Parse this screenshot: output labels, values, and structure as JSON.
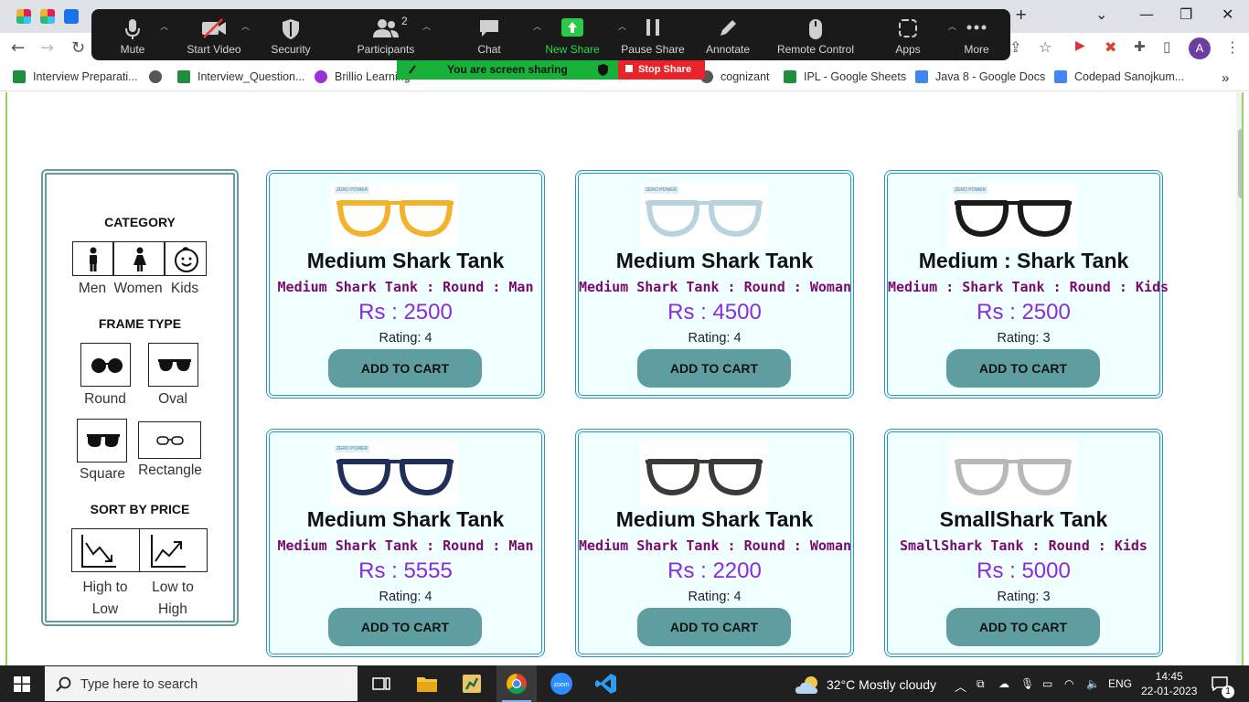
{
  "browser": {
    "bookmarks": [
      "Interview Preparati...",
      "Interview_Question...",
      "Brillio Learning",
      "cognizant",
      "IPL - Google Sheets",
      "Java 8 - Google Docs",
      "Codepad Sanojkum..."
    ],
    "overflow": "»",
    "avatar": "A"
  },
  "zoom": {
    "buttons": [
      {
        "label": "Mute",
        "icon": "microphone-icon"
      },
      {
        "label": "Start Video",
        "icon": "video-off-icon"
      },
      {
        "label": "Security",
        "icon": "shield-icon"
      },
      {
        "label": "Participants",
        "icon": "participants-icon",
        "count": "2"
      },
      {
        "label": "Chat",
        "icon": "chat-icon"
      },
      {
        "label": "New Share",
        "icon": "share-arrow-icon"
      },
      {
        "label": "Pause Share",
        "icon": "pause-icon"
      },
      {
        "label": "Annotate",
        "icon": "pencil-icon"
      },
      {
        "label": "Remote Control",
        "icon": "mouse-icon"
      },
      {
        "label": "Apps",
        "icon": "apps-icon"
      },
      {
        "label": "More",
        "icon": "more-dots-icon"
      }
    ],
    "sharing_status": "You are screen sharing",
    "stop_share": "Stop Share"
  },
  "filters": {
    "category_heading": "CATEGORY",
    "categories": [
      "Men",
      "Women",
      "Kids"
    ],
    "frame_heading": "FRAME TYPE",
    "frames": [
      "Round",
      "Oval",
      "Square",
      "Rectangle"
    ],
    "sort_heading": "SORT BY PRICE",
    "sort_high_low": {
      "line1": "High to",
      "line2": "Low"
    },
    "sort_low_high": {
      "line1": "Low to",
      "line2": "High"
    }
  },
  "products": [
    {
      "title": "Medium Shark Tank",
      "subtitle": "Medium Shark Tank : Round : Man",
      "price": "Rs : 2500",
      "rating": "Rating: 4",
      "badge": "ZERO POWER",
      "frame_color": "#f2b32a",
      "button": "ADD TO CART"
    },
    {
      "title": "Medium Shark Tank",
      "subtitle": "Medium Shark Tank : Round : Woman",
      "price": "Rs : 4500",
      "rating": "Rating: 4",
      "badge": "ZERO POWER",
      "frame_color": "#b9d3de",
      "button": "ADD TO CART"
    },
    {
      "title": "Medium : Shark Tank",
      "subtitle": "Medium : Shark Tank : Round : Kids",
      "price": "Rs : 2500",
      "rating": "Rating: 3",
      "badge": "ZERO POWER",
      "frame_color": "#1a1a1a",
      "button": "ADD TO CART"
    },
    {
      "title": "Medium Shark Tank",
      "subtitle": "Medium Shark Tank : Round : Man",
      "price": "Rs : 5555",
      "rating": "Rating: 4",
      "badge": "ZERO POWER",
      "frame_color": "#1f2f5a",
      "button": "ADD TO CART"
    },
    {
      "title": "Medium Shark Tank",
      "subtitle": "Medium Shark Tank : Round : Woman",
      "price": "Rs : 2200",
      "rating": "Rating: 4",
      "badge": "",
      "frame_color": "#3a3a36",
      "button": "ADD TO CART"
    },
    {
      "title": "SmallShark Tank",
      "subtitle": "SmallShark Tank : Round : Kids",
      "price": "Rs : 5000",
      "rating": "Rating: 3",
      "badge": "",
      "frame_color": "#b8b8b8",
      "button": "ADD TO CART"
    }
  ],
  "taskbar": {
    "search_placeholder": "Type here to search",
    "weather": "32°C  Mostly cloudy",
    "language": "ENG",
    "time": "14:45",
    "date": "22-01-2023",
    "notifications": "1"
  }
}
